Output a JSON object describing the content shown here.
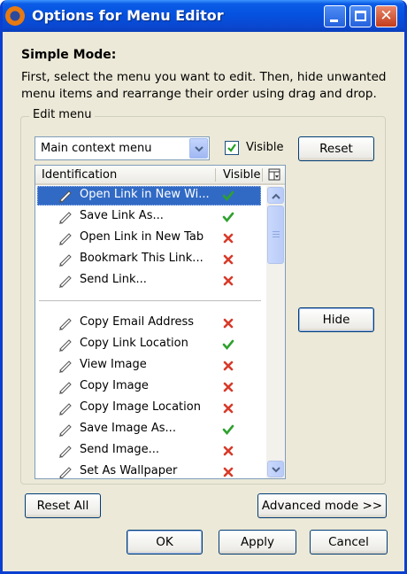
{
  "window": {
    "title": "Options for Menu Editor"
  },
  "simple_mode": {
    "title": "Simple Mode:",
    "description": "First, select the menu you want to edit. Then, hide unwanted menu items and rearrange their order using drag and drop."
  },
  "edit_menu": {
    "label": "Edit menu",
    "menu_select": "Main context menu",
    "visible_checkbox": {
      "label": "Visible",
      "checked": true
    },
    "reset_label": "Reset",
    "hide_label": "Hide",
    "columns": {
      "identification": "Identification",
      "visible": "Visible"
    },
    "items": [
      {
        "label": "Open Link in New Wi...",
        "visible": true,
        "selected": true
      },
      {
        "label": "Save Link As...",
        "visible": true
      },
      {
        "label": "Open Link in New Tab",
        "visible": false
      },
      {
        "label": "Bookmark This Link...",
        "visible": false
      },
      {
        "label": "Send Link...",
        "visible": false
      },
      {
        "separator": true
      },
      {
        "label": "Copy Email Address",
        "visible": false
      },
      {
        "label": "Copy Link Location",
        "visible": true
      },
      {
        "label": "View Image",
        "visible": false
      },
      {
        "label": "Copy Image",
        "visible": false
      },
      {
        "label": "Copy Image Location",
        "visible": false
      },
      {
        "label": "Save Image As...",
        "visible": true
      },
      {
        "label": "Send Image...",
        "visible": false
      },
      {
        "label": "Set As Wallpaper",
        "visible": false
      }
    ]
  },
  "footer": {
    "reset_all": "Reset All",
    "advanced_mode": "Advanced mode >>",
    "ok": "OK",
    "apply": "Apply",
    "cancel": "Cancel"
  },
  "colors": {
    "titlebar": "#0552e0",
    "selection": "#316ac5",
    "visible_check": "#2ea12e",
    "hidden_x": "#d83a2a"
  }
}
